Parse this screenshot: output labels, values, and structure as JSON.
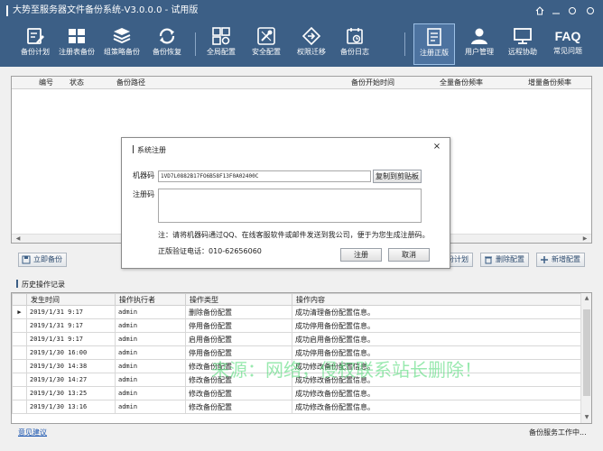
{
  "window": {
    "title": "大势至服务器文件备份系统-V3.0.0.0 - 试用版",
    "controls": [
      "home-icon",
      "minimize-icon",
      "restore-icon",
      "close-icon"
    ]
  },
  "toolbar": {
    "items": [
      {
        "label": "备份计划",
        "icon": "backup-plan-icon"
      },
      {
        "label": "注册表备份",
        "icon": "registry-backup-icon"
      },
      {
        "label": "组策略备份",
        "icon": "group-policy-icon"
      },
      {
        "label": "备份恢复",
        "icon": "restore-icon"
      },
      {
        "label": "全局配置",
        "icon": "global-config-icon"
      },
      {
        "label": "安全配置",
        "icon": "security-config-icon"
      },
      {
        "label": "权限迁移",
        "icon": "permission-migrate-icon"
      },
      {
        "label": "备份日志",
        "icon": "backup-log-icon"
      },
      {
        "label": "注册正版",
        "icon": "register-icon"
      },
      {
        "label": "用户管理",
        "icon": "user-manage-icon"
      },
      {
        "label": "远程协助",
        "icon": "remote-assist-icon"
      },
      {
        "label": "常见问题",
        "icon": "faq-icon"
      }
    ],
    "faq_glyph": "FAQ"
  },
  "main_table": {
    "columns": [
      "编号",
      "状态",
      "备份路径",
      "备份开始时间",
      "全量备份频率",
      "增量备份频率"
    ]
  },
  "actions": {
    "backup_now": "立即备份",
    "plan_partial": "份计划",
    "delete_config": "删除配置",
    "add_config": "新增配置"
  },
  "history": {
    "label": "历史操作记录",
    "columns": [
      "发生时间",
      "操作执行者",
      "操作类型",
      "操作内容"
    ],
    "rows": [
      {
        "time": "2019/1/31 9:17",
        "user": "admin",
        "type": "删除备份配置",
        "content": "成功清理备份配置信息。"
      },
      {
        "time": "2019/1/31 9:17",
        "user": "admin",
        "type": "停用备份配置",
        "content": "成功停用备份配置信息。"
      },
      {
        "time": "2019/1/31 9:17",
        "user": "admin",
        "type": "启用备份配置",
        "content": "成功启用备份配置信息。"
      },
      {
        "time": "2019/1/30 16:00",
        "user": "admin",
        "type": "停用备份配置",
        "content": "成功停用备份配置信息。"
      },
      {
        "time": "2019/1/30 14:38",
        "user": "admin",
        "type": "修改备份配置",
        "content": "成功修改备份配置信息。"
      },
      {
        "time": "2019/1/30 14:27",
        "user": "admin",
        "type": "修改备份配置",
        "content": "成功修改备份配置信息。"
      },
      {
        "time": "2019/1/30 13:25",
        "user": "admin",
        "type": "修改备份配置",
        "content": "成功修改备份配置信息。"
      },
      {
        "time": "2019/1/30 13:16",
        "user": "admin",
        "type": "修改备份配置",
        "content": "成功修改备份配置信息。"
      }
    ],
    "current_row_marker": "▶"
  },
  "watermark": "来源：网络，侵权联系站长删除！",
  "status": {
    "feedback": "意见建议",
    "service": "备份服务工作中..."
  },
  "dialog": {
    "title": "系统注册",
    "close": "×",
    "machine_label": "机器码",
    "machine_code": "1VD7L0882B17FO6B58F13F0A02400C",
    "copy_button": "复制到剪贴板",
    "reg_label": "注册码",
    "note": "注：请将机器码通过QQ、在线客服软件或邮件发送到我公司，便于为您生成注册码。",
    "phone": "正版验证电话：010-62656060",
    "ok": "注册",
    "cancel": "取消"
  },
  "colors": {
    "titlebar": "#3c5f86",
    "toolbar": "#3c5f86",
    "link": "#1a55b0",
    "watermark": "#46d76e"
  }
}
